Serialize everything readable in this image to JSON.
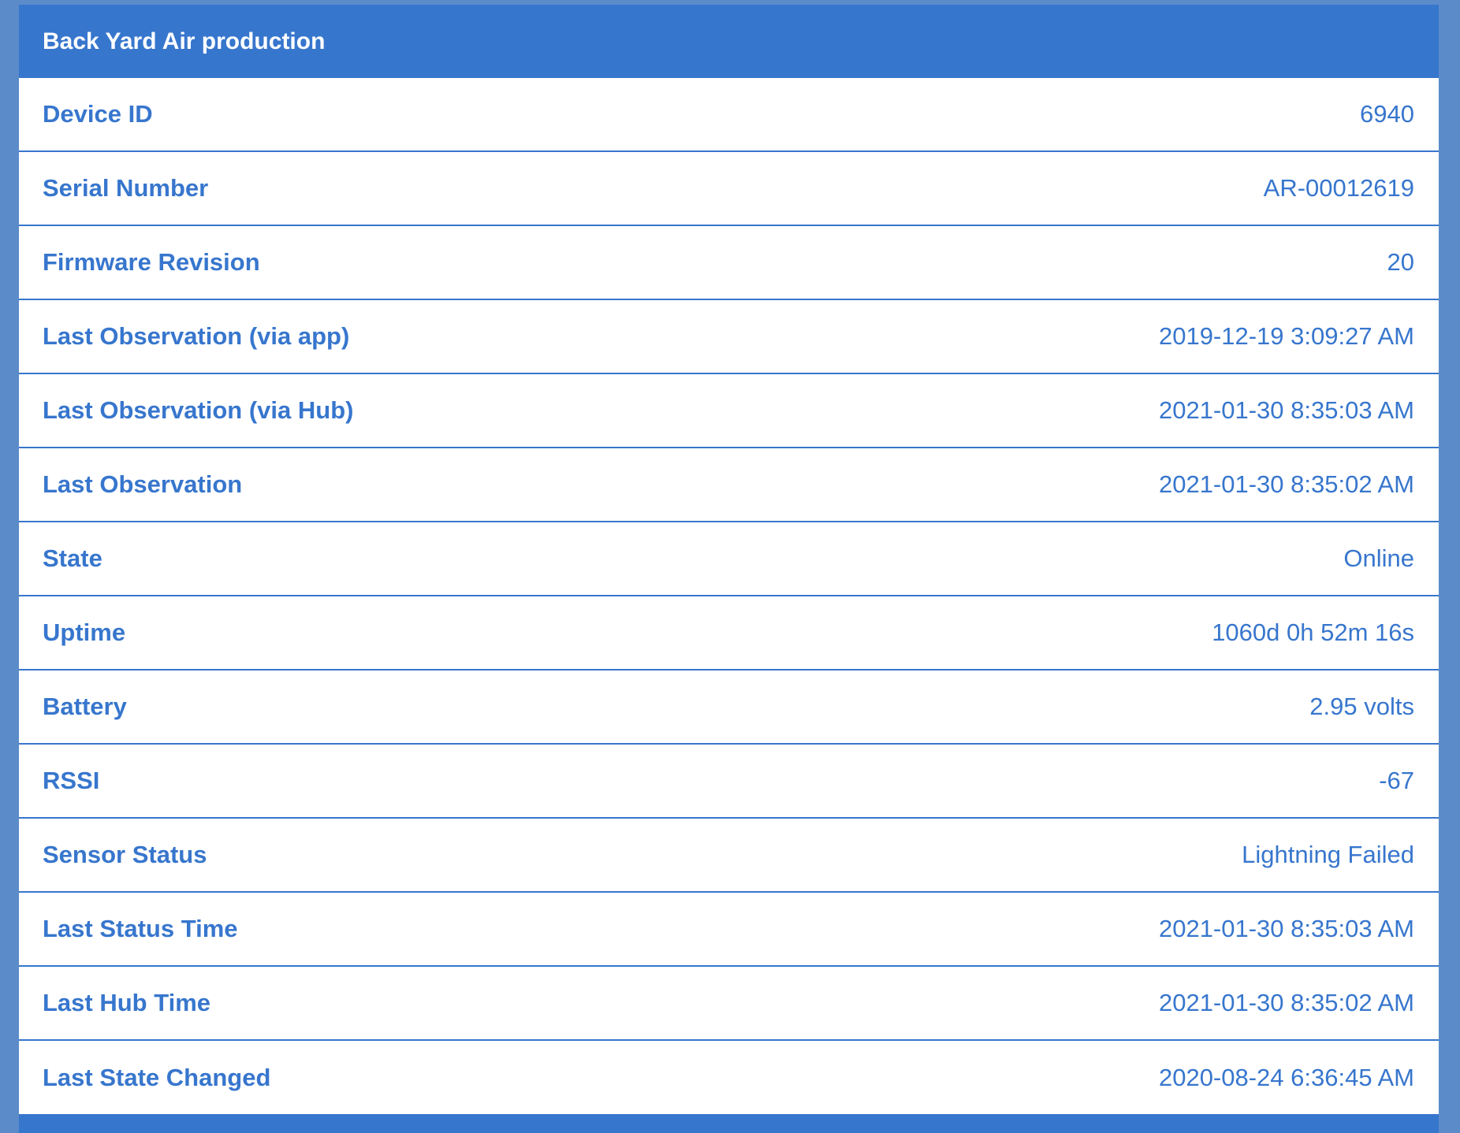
{
  "panel": {
    "title": "Back Yard Air production"
  },
  "rows": [
    {
      "label": "Device ID",
      "value": "6940"
    },
    {
      "label": "Serial Number",
      "value": "AR-00012619"
    },
    {
      "label": "Firmware Revision",
      "value": "20"
    },
    {
      "label": "Last Observation (via app)",
      "value": "2019-12-19 3:09:27 AM"
    },
    {
      "label": "Last Observation (via Hub)",
      "value": "2021-01-30 8:35:03 AM"
    },
    {
      "label": "Last Observation",
      "value": "2021-01-30 8:35:02 AM"
    },
    {
      "label": "State",
      "value": "Online"
    },
    {
      "label": "Uptime",
      "value": "1060d 0h 52m 16s"
    },
    {
      "label": "Battery",
      "value": "2.95 volts"
    },
    {
      "label": "RSSI",
      "value": "-67"
    },
    {
      "label": "Sensor Status",
      "value": "Lightning Failed"
    },
    {
      "label": "Last Status Time",
      "value": "2021-01-30 8:35:03 AM"
    },
    {
      "label": "Last Hub Time",
      "value": "2021-01-30 8:35:02 AM"
    },
    {
      "label": "Last State Changed",
      "value": "2020-08-24 6:36:45 AM"
    }
  ],
  "colors": {
    "accent": "#3776cd",
    "page_background": "#5b8bc9",
    "panel_background": "#ffffff"
  }
}
